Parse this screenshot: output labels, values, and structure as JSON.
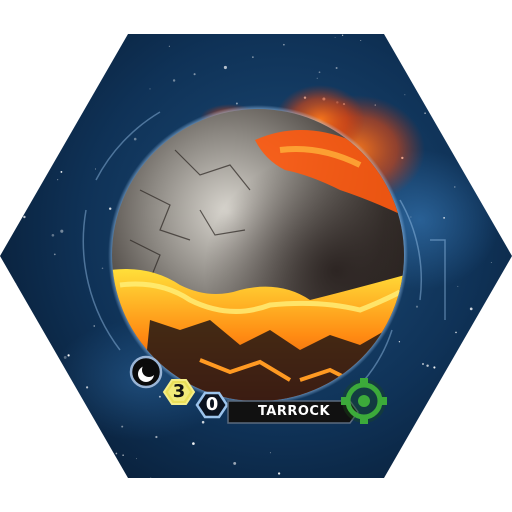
{
  "planet": {
    "name": "TARROCK",
    "resources": "3",
    "influence": "0"
  },
  "icons": {
    "trait": "moon-crescent-icon",
    "tech_specialty": "green-cog-icon"
  },
  "colors": {
    "space": "#0e2a4a",
    "lava": "#ff6a10",
    "resource_ring": "#e6d94a",
    "influence_ring": "#8fb7e6",
    "specialty": "#3caa3a",
    "label_bg": "#111111"
  }
}
